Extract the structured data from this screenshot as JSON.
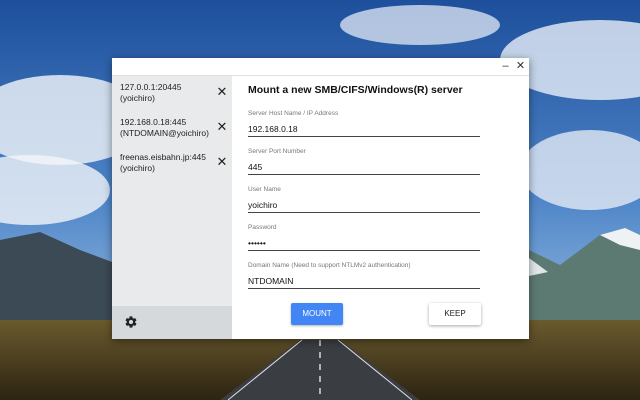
{
  "window": {
    "minimize_symbol": "–",
    "close_symbol": "✕"
  },
  "sidebar": {
    "servers": [
      {
        "host": "127.0.0.1:20445",
        "user": "(yoichiro)",
        "remove": "✕"
      },
      {
        "host": "192.168.0.18:445",
        "user": "(NTDOMAIN@yoichiro)",
        "remove": "✕"
      },
      {
        "host": "freenas.eisbahn.jp:445",
        "user": "(yoichiro)",
        "remove": "✕"
      }
    ],
    "settings_icon": "gear-icon"
  },
  "form": {
    "title": "Mount a new SMB/CIFS/Windows(R) server",
    "fields": {
      "host": {
        "label": "Server Host Name / IP Address",
        "value": "192.168.0.18"
      },
      "port": {
        "label": "Server Port Number",
        "value": "445"
      },
      "username": {
        "label": "User Name",
        "value": "yoichiro"
      },
      "password": {
        "label": "Password",
        "value": "••••••"
      },
      "domain": {
        "label": "Domain Name (Need to support NTLMv2 authentication)",
        "value": "NTDOMAIN"
      }
    },
    "mount_label": "MOUNT",
    "keep_label": "KEEP"
  },
  "colors": {
    "accent": "#4285f4",
    "sidebar_bg": "#e9eaeb",
    "sidebar_footer_bg": "#d6d9db"
  }
}
